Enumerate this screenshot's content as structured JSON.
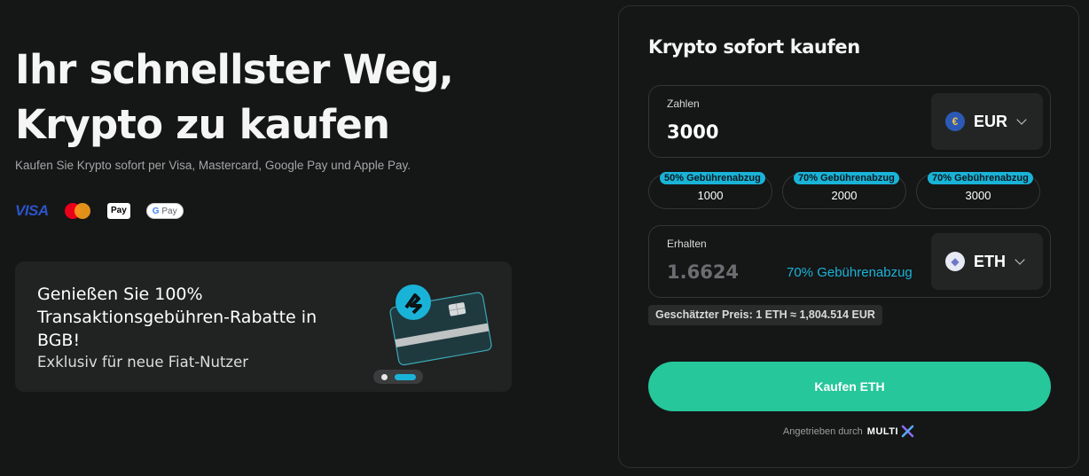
{
  "hero": {
    "title_line1": "Ihr schnellster Weg,",
    "title_line2": "Krypto zu kaufen",
    "subtitle": "Kaufen Sie Krypto sofort per Visa, Mastercard, Google Pay und Apple Pay."
  },
  "payment_methods": {
    "visa": "VISA",
    "apple_pay": "Pay",
    "google_pay_g": "G",
    "google_pay": "Pay"
  },
  "promo": {
    "title": "Genießen Sie 100% Transaktionsgebühren-Rabatte in BGB!",
    "subtitle": "Exklusiv für neue Fiat-Nutzer",
    "slide_count": 2,
    "active_slide": 2
  },
  "panel": {
    "title": "Krypto sofort kaufen",
    "pay": {
      "label": "Zahlen",
      "value": "3000",
      "currency": "EUR",
      "currency_icon": "€"
    },
    "quick_amounts": [
      {
        "tag": "50% Gebührenabzug",
        "value": "1000"
      },
      {
        "tag": "70% Gebührenabzug",
        "value": "2000"
      },
      {
        "tag": "70% Gebührenabzug",
        "value": "3000"
      }
    ],
    "receive": {
      "label": "Erhalten",
      "value": "1.6624",
      "fee_note": "70% Gebührenabzug",
      "currency": "ETH",
      "currency_icon": "◆"
    },
    "estimated_price": "Geschätzter Preis: 1 ETH ≈ 1,804.514 EUR",
    "buy_label": "Kaufen ETH",
    "powered_by": "Angetrieben durch",
    "powered_brand": "MULTI",
    "powered_brand_x": "✕"
  },
  "colors": {
    "accent_cyan": "#1ab3d8",
    "buy_green": "#26c79b",
    "background": "#151616"
  }
}
